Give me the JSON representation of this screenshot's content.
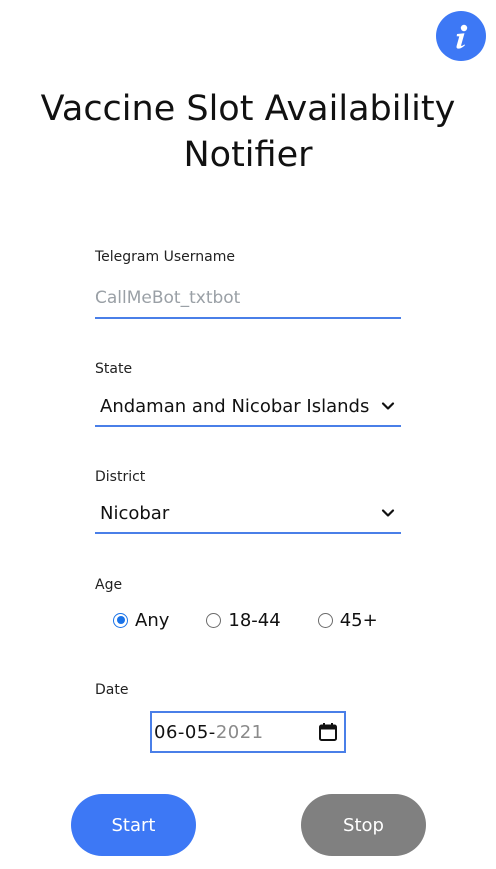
{
  "header": {
    "title": "Vaccine Slot Availability Notifier",
    "info_icon": "info-icon"
  },
  "form": {
    "telegram": {
      "label": "Telegram Username",
      "placeholder": "CallMeBot_txtbot",
      "value": ""
    },
    "state": {
      "label": "State",
      "selected": "Andaman and Nicobar Islands"
    },
    "district": {
      "label": "District",
      "selected": "Nicobar"
    },
    "age": {
      "label": "Age",
      "options": [
        "Any",
        "18-44",
        "45+"
      ],
      "selected": "Any"
    },
    "date": {
      "label": "Date",
      "day_month": "06-05-",
      "year": "2021"
    }
  },
  "actions": {
    "start_label": "Start",
    "stop_label": "Stop"
  },
  "colors": {
    "accent": "#3d78f5",
    "underline": "#4a7fe8",
    "stop_button": "#808080",
    "radio_selected": "#1a73e8"
  }
}
